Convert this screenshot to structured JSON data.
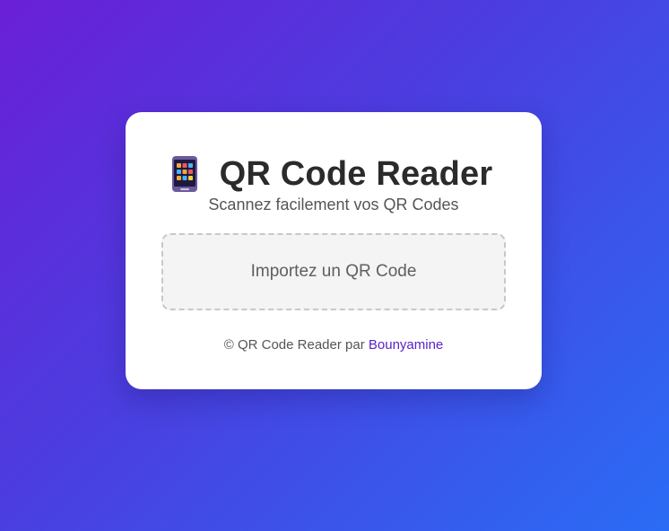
{
  "header": {
    "icon": "mobile-phone-icon",
    "title": "QR Code Reader",
    "subtitle": "Scannez facilement vos QR Codes"
  },
  "upload": {
    "label": "Importez un QR Code"
  },
  "footer": {
    "prefix": "© QR Code Reader par",
    "author_link": "Bounyamine"
  },
  "colors": {
    "background_start": "#6a1fd6",
    "background_end": "#2a6cf5",
    "card": "#ffffff",
    "title": "#2b2b2b",
    "link": "#5a22c8"
  }
}
